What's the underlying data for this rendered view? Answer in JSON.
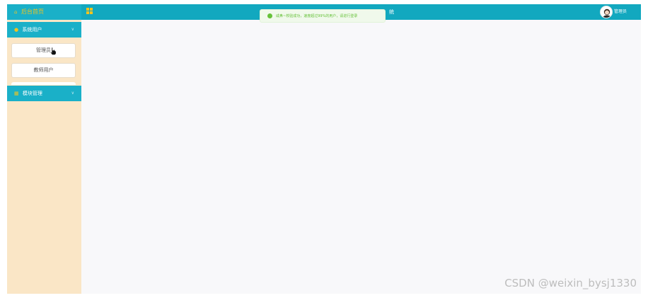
{
  "header": {
    "brand_label": "后台首页",
    "system_title_visible": "统",
    "user_name": "管理员"
  },
  "toast": {
    "message": "咸鼻~校验成功，速度超过99%的用户，请进行登录",
    "type": "success"
  },
  "sidebar": {
    "menus": [
      {
        "label": "系统用户",
        "expanded": true,
        "items": [
          {
            "label": "管理员"
          },
          {
            "label": "教师用户"
          }
        ]
      },
      {
        "label": "模块管理",
        "expanded": false
      }
    ]
  },
  "watermark": "CSDN @weixin_bysj1330",
  "colors": {
    "header_bg": "#12a8bf",
    "menu_bg": "#1ab0c8",
    "sidebar_bg": "#fae6c6",
    "accent": "#f3c41f",
    "content_bg": "#f8f8fa",
    "toast_green": "#67c23a"
  },
  "icons": {
    "brand": "home-icon",
    "grid": "grid-icon",
    "user_menu": "user-icon",
    "module_menu": "module-icon",
    "chevron": "chevron-down-icon",
    "toast": "success-check-icon"
  }
}
